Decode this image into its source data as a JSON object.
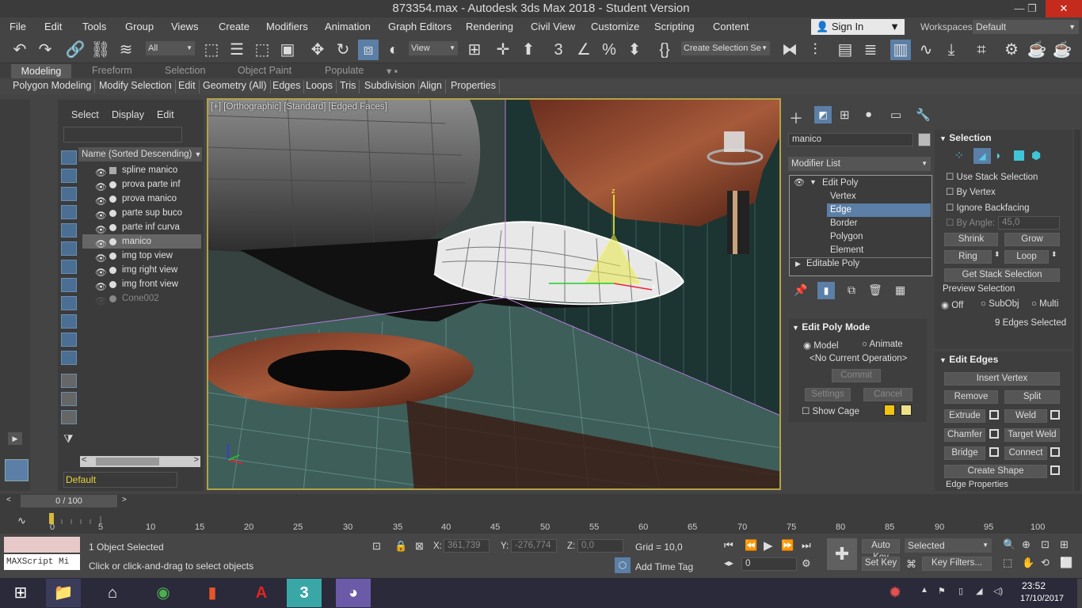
{
  "title": "873354.max - Autodesk 3ds Max 2018 - Student Version",
  "menus": [
    "File",
    "Edit",
    "Tools",
    "Group",
    "Views",
    "Create",
    "Modifiers",
    "Animation",
    "Graph Editors",
    "Rendering",
    "Civil View",
    "Customize",
    "Scripting",
    "Content"
  ],
  "sign_in": "Sign In",
  "workspaces_label": "Workspaces:",
  "workspace_value": "Default",
  "filter_value": "All",
  "view_value": "View",
  "selection_set": "Create Selection Se",
  "ribbon_tabs": [
    "Modeling",
    "Freeform",
    "Selection",
    "Object Paint",
    "Populate"
  ],
  "ribbon_items": [
    "Polygon Modeling",
    "Modify Selection",
    "Edit",
    "Geometry (All)",
    "Edges",
    "Loops",
    "Tris",
    "Subdivision",
    "Align",
    "Properties"
  ],
  "scene_tabs": [
    "Select",
    "Display",
    "Edit"
  ],
  "scene_header": "Name (Sorted Descending)",
  "scene_items": [
    "spline manico",
    "prova parte inf",
    "prova manico",
    "parte sup buco",
    "parte inf curva",
    "manico",
    "img top view",
    "img right view",
    "img front view",
    "Cone002"
  ],
  "layer": "Default",
  "viewport_label": "[+] [Orthographic] [Standard] [Edged Faces]",
  "object_name": "manico",
  "modifier_list": "Modifier List",
  "stack": [
    "Edit Poly",
    "Vertex",
    "Edge",
    "Border",
    "Polygon",
    "Element",
    "Editable Poly"
  ],
  "selection_rollout": {
    "title": "Selection",
    "use_stack": "Use Stack Selection",
    "by_vertex": "By Vertex",
    "ignore_backfacing": "Ignore Backfacing",
    "by_angle": "By Angle:",
    "angle_value": "45,0",
    "shrink": "Shrink",
    "grow": "Grow",
    "ring": "Ring",
    "loop": "Loop",
    "get_stack": "Get Stack Selection",
    "preview": "Preview Selection",
    "off": "Off",
    "subobj": "SubObj",
    "multi": "Multi",
    "count": "9 Edges Selected"
  },
  "edit_poly_mode": {
    "title": "Edit Poly Mode",
    "model": "Model",
    "animate": "Animate",
    "current_op": "<No Current Operation>",
    "commit": "Commit",
    "settings": "Settings",
    "cancel": "Cancel",
    "show_cage": "Show Cage"
  },
  "edit_edges": {
    "title": "Edit Edges",
    "insert_vertex": "Insert Vertex",
    "remove": "Remove",
    "split": "Split",
    "extrude": "Extrude",
    "weld": "Weld",
    "chamfer": "Chamfer",
    "target_weld": "Target Weld",
    "bridge": "Bridge",
    "connect": "Connect",
    "create_shape": "Create Shape",
    "edge_properties": "Edge Properties"
  },
  "timeline": {
    "frame": "0 / 100",
    "ticks": [
      "0",
      "5",
      "10",
      "15",
      "20",
      "25",
      "30",
      "35",
      "40",
      "45",
      "50",
      "55",
      "60",
      "65",
      "70",
      "75",
      "80",
      "85",
      "90",
      "95",
      "100"
    ]
  },
  "status": {
    "maxscript": "MAXScript Mi",
    "selected": "1 Object Selected",
    "prompt": "Click or click-and-drag to select objects",
    "x_label": "X:",
    "x": "361,739",
    "y_label": "Y:",
    "y": "-276,774",
    "z_label": "Z:",
    "z": "0,0",
    "grid": "Grid = 10,0",
    "add_time_tag": "Add Time Tag",
    "auto_key": "Auto Key",
    "set_key": "Set Key",
    "selected_dd": "Selected",
    "key_filters": "Key Filters...",
    "frame_field": "0"
  },
  "clock": {
    "time": "23:52",
    "date": "17/10/2017"
  }
}
